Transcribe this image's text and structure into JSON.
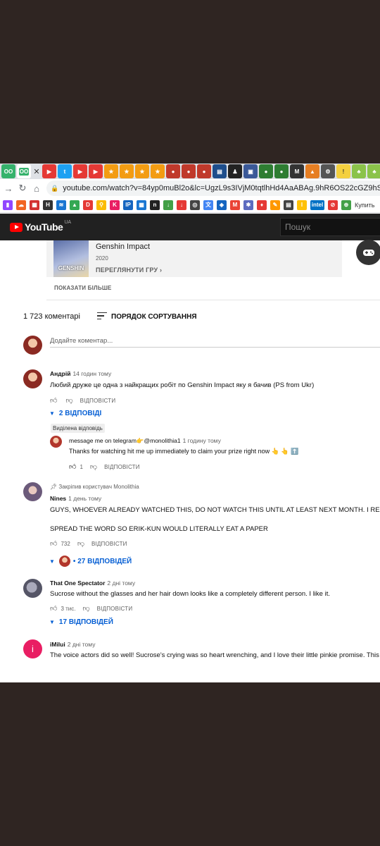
{
  "colors": {
    "youtube_red": "#ff0000",
    "link_blue": "#065fd4",
    "masthead_bg": "#212121",
    "outer_bg": "#2f2522"
  },
  "browser": {
    "url": "youtube.com/watch?v=84yp0muBl2o&lc=UgzL9s3IVjM0tqtlhHd4AaABAg.9hR6OS22cGZ9hSYSx0gfWA&ab_c",
    "bookmark_label": "Купить"
  },
  "masthead": {
    "logo_text": "YouTube",
    "country": "UA",
    "search_placeholder": "Пошук"
  },
  "game_card": {
    "thumb_text": "GENSHIN",
    "title": "Genshin Impact",
    "year": "2020",
    "browse_label": "ПЕРЕГЛЯНУТИ ГРУ"
  },
  "show_more": "ПОКАЗАТИ БІЛЬШЕ",
  "comments": {
    "count": "1 723 коментарі",
    "sort_label": "ПОРЯДОК СОРТУВАННЯ",
    "add_placeholder": "Додайте коментар...",
    "reply_label": "ВІДПОВІСТИ",
    "items": [
      {
        "author": "Андрій",
        "time": "14 годин тому",
        "text": "Любий друже це одна з найкращих робіт по Genshin Impact яку я бачив (PS from Ukr)",
        "likes": "",
        "replies": "2 ВІДПОВІДІ"
      },
      {
        "pinned": "Закріпив користувач Monolithia",
        "author": "Nines",
        "time": "1 день тому",
        "text": "GUYS, WHOEVER ALREADY WATCHED THIS, DO NOT WATCH THIS UNTIL AT LEAST NEXT MONTH. I REPEAT, DO",
        "text2": "SPREAD THE WORD SO ERIK-KUN WOULD LITERALLY EAT A PAPER",
        "likes": "732",
        "replies": "• 27 ВІДПОВІДЕЙ"
      },
      {
        "author": "That One Spectator",
        "time": "2 дні тому",
        "text": "Sucrose without the glasses and her hair down looks like a completely different person. I like it.",
        "likes": "3 тис.",
        "replies": "17 ВІДПОВІДЕЙ"
      },
      {
        "author": "iMilui",
        "time": "2 дні тому",
        "avatar_letter": "i",
        "text": "The voice actors did so well! Sucrose's crying was so heart wrenching, and I love their little pinkie promise. This w"
      }
    ],
    "highlighted_reply": {
      "badge": "Виділена відповідь",
      "author": "message me on telegram👉@monolithia1",
      "time": "1 годину тому",
      "text": "Thanks for watching hit me up immediately to claim your prize right now 👆 👆 ⬆️",
      "likes": "1"
    }
  }
}
